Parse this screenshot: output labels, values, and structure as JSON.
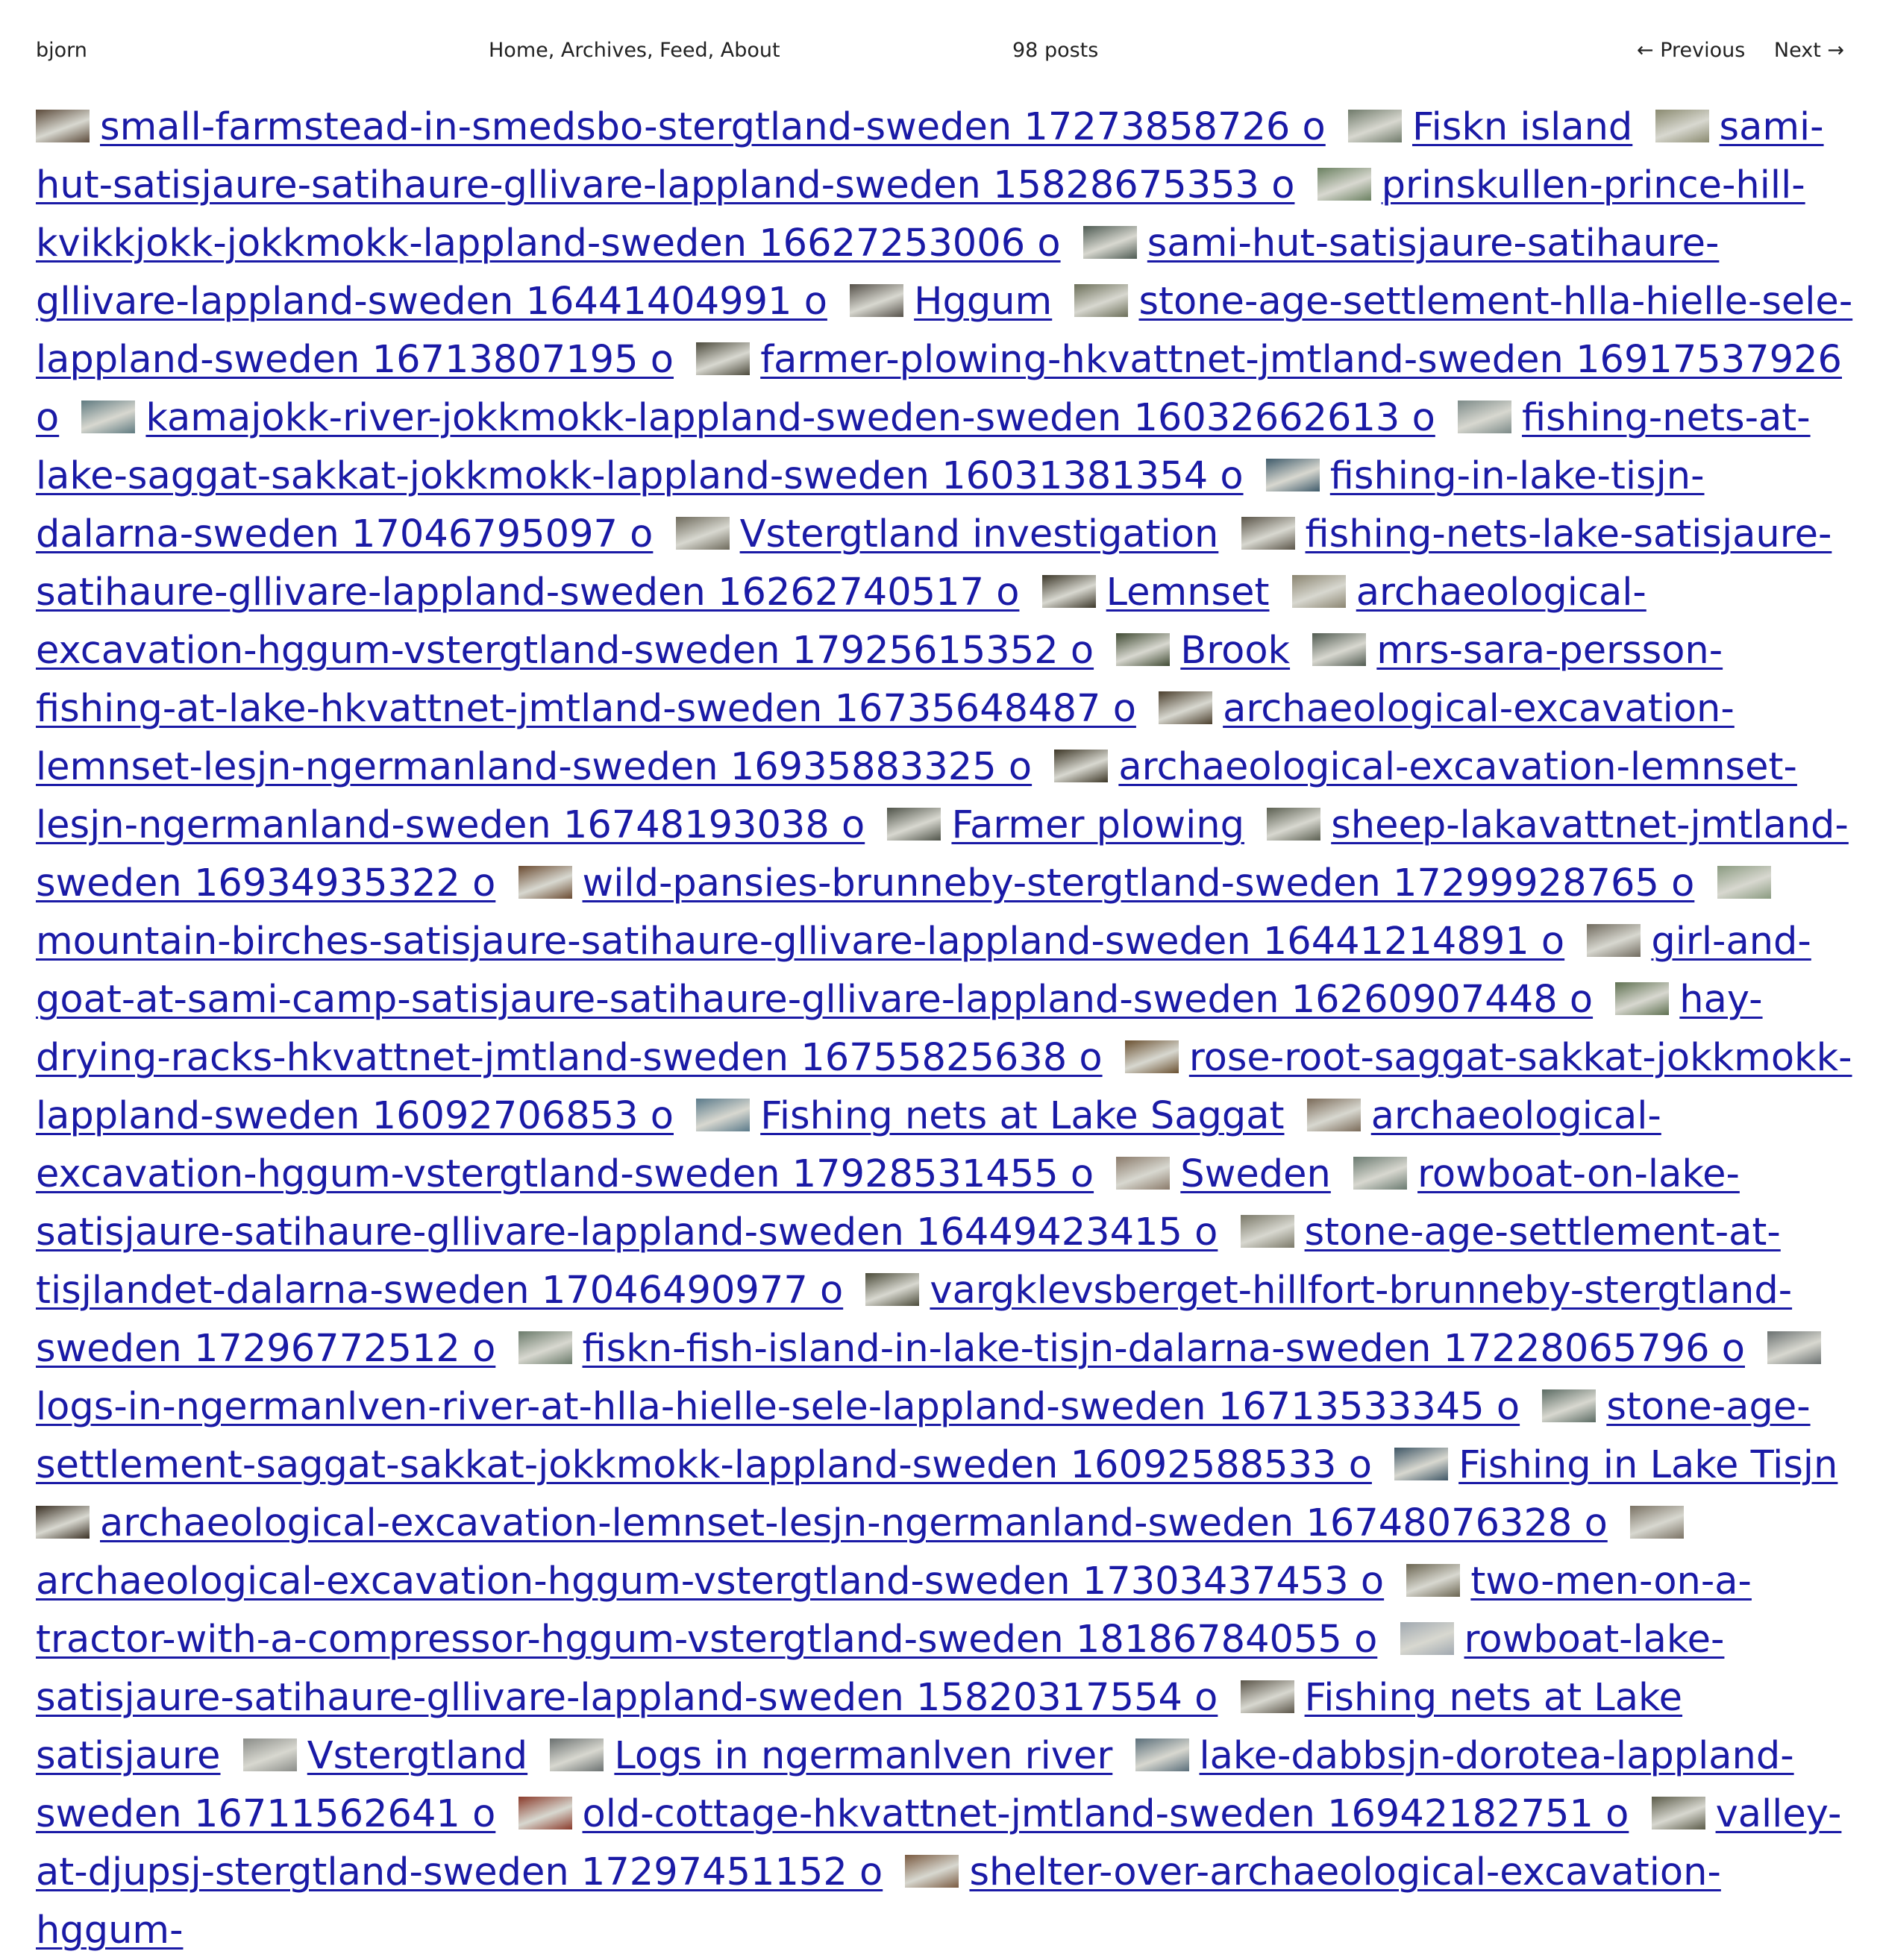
{
  "header": {
    "site_title": "bjorn",
    "nav": [
      "Home",
      "Archives",
      "Feed",
      "About"
    ],
    "post_count": "98 posts",
    "prev_label": "← Previous",
    "next_label": "Next →"
  },
  "posts": [
    {
      "title": "small-farmstead-in-smedsbo-stergtland-sweden 17273858726 o",
      "thumb_color": "#5b4a3a"
    },
    {
      "title": "Fiskn island",
      "thumb_color": "#6f7a6a"
    },
    {
      "title": "sami-hut-satisjaure-satihaure-gllivare-lappland-sweden 15828675353 o",
      "thumb_color": "#8a8a70"
    },
    {
      "title": "prinskullen-prince-hill-kvikkjokk-jokkmokk-lappland-sweden 16627253006 o",
      "thumb_color": "#6a8060"
    },
    {
      "title": "sami-hut-satisjaure-satihaure-gllivare-lappland-sweden 16441404991 o",
      "thumb_color": "#4d5a52"
    },
    {
      "title": "Hggum",
      "thumb_color": "#555049"
    },
    {
      "title": "stone-age-settlement-hlla-hielle-sele-lappland-sweden 16713807195 o",
      "thumb_color": "#6b6e58"
    },
    {
      "title": "farmer-plowing-hkvattnet-jmtland-sweden 16917537926 o",
      "thumb_color": "#4c4a3c"
    },
    {
      "title": "kamajokk-river-jokkmokk-lappland-sweden-sweden 16032662613 o",
      "thumb_color": "#5f7a80"
    },
    {
      "title": "fishing-nets-at-lake-saggat-sakkat-jokkmokk-lappland-sweden 16031381354 o",
      "thumb_color": "#7c8a88"
    },
    {
      "title": "fishing-in-lake-tisjn-dalarna-sweden 17046795097 o",
      "thumb_color": "#3e5a6a"
    },
    {
      "title": "Vstergtland investigation",
      "thumb_color": "#6e6a5c"
    },
    {
      "title": "fishing-nets-lake-satisjaure-satihaure-gllivare-lappland-sweden 16262740517 o",
      "thumb_color": "#5a5448"
    },
    {
      "title": "Lemnset",
      "thumb_color": "#3b3628"
    },
    {
      "title": "archaeological-excavation-hggum-vstergtland-sweden 17925615352 o",
      "thumb_color": "#8a8470"
    },
    {
      "title": "Brook",
      "thumb_color": "#3f4a32"
    },
    {
      "title": "mrs-sara-persson-fishing-at-lake-hkvattnet-jmtland-sweden 16735648487 o",
      "thumb_color": "#505a50"
    },
    {
      "title": "archaeological-excavation-lemnset-lesjn-ngermanland-sweden 16935883325 o",
      "thumb_color": "#4a3e2c"
    },
    {
      "title": "archaeological-excavation-lemnset-lesjn-ngermanland-sweden 16748193038 o",
      "thumb_color": "#3c3626"
    },
    {
      "title": "Farmer plowing",
      "thumb_color": "#4e5248"
    },
    {
      "title": "sheep-lakavattnet-jmtland-sweden 16934935322 o",
      "thumb_color": "#5a5e50"
    },
    {
      "title": "wild-pansies-brunneby-stergtland-sweden 17299928765 o",
      "thumb_color": "#6a4a30"
    },
    {
      "title": "mountain-birches-satisjaure-satihaure-gllivare-lappland-sweden 16441214891 o",
      "thumb_color": "#8a9a80"
    },
    {
      "title": "girl-and-goat-at-sami-camp-satisjaure-satihaure-gllivare-lappland-sweden 16260907448 o",
      "thumb_color": "#706a5e"
    },
    {
      "title": "hay-drying-racks-hkvattnet-jmtland-sweden 16755825638 o",
      "thumb_color": "#5e7050"
    },
    {
      "title": "rose-root-saggat-sakkat-jokkmokk-lappland-sweden 16092706853 o",
      "thumb_color": "#6a5030"
    },
    {
      "title": "Fishing nets at Lake Saggat",
      "thumb_color": "#5a7a8a"
    },
    {
      "title": "archaeological-excavation-hggum-vstergtland-sweden 17928531455 o",
      "thumb_color": "#7a6a58"
    },
    {
      "title": "Sweden",
      "thumb_color": "#8a7a6a"
    },
    {
      "title": "rowboat-on-lake-satisjaure-satihaure-gllivare-lappland-sweden 16449423415 o",
      "thumb_color": "#6a7a70"
    },
    {
      "title": "stone-age-settlement-at-tisjlandet-dalarna-sweden 17046490977 o",
      "thumb_color": "#7a7868"
    },
    {
      "title": "vargklevsberget-hillfort-brunneby-stergtland-sweden 17296772512 o",
      "thumb_color": "#4a4a38"
    },
    {
      "title": "fiskn-fish-island-in-lake-tisjn-dalarna-sweden 17228065796 o",
      "thumb_color": "#6a7a6a"
    },
    {
      "title": "logs-in-ngermanlven-river-at-hlla-hielle-sele-lappland-sweden 16713533345 o",
      "thumb_color": "#6a7070"
    },
    {
      "title": "stone-age-settlement-saggat-sakkat-jokkmokk-lappland-sweden 16092588533 o",
      "thumb_color": "#5a6a62"
    },
    {
      "title": "Fishing in Lake Tisjn",
      "thumb_color": "#3e5666"
    },
    {
      "title": "archaeological-excavation-lemnset-lesjn-ngermanland-sweden 16748076328 o",
      "thumb_color": "#3a3024"
    },
    {
      "title": "archaeological-excavation-hggum-vstergtland-sweden 17303437453 o",
      "thumb_color": "#7a7264"
    },
    {
      "title": "two-men-on-a-tractor-with-a-compressor-hggum-vstergtland-sweden 18186784055 o",
      "thumb_color": "#6a6450"
    },
    {
      "title": "rowboat-lake-satisjaure-satihaure-gllivare-lappland-sweden 15820317554 o",
      "thumb_color": "#a0a8b0"
    },
    {
      "title": "Fishing nets at Lake satisjaure",
      "thumb_color": "#5a5448"
    },
    {
      "title": "Vstergtland",
      "thumb_color": "#8a8c88"
    },
    {
      "title": "Logs in ngermanlven river",
      "thumb_color": "#6a7070"
    },
    {
      "title": "lake-dabbsjn-dorotea-lappland-sweden 16711562641 o",
      "thumb_color": "#5a6e7a"
    },
    {
      "title": "old-cottage-hkvattnet-jmtland-sweden 16942182751 o",
      "thumb_color": "#8a3a2a"
    },
    {
      "title": "valley-at-djupsj-stergtland-sweden 17297451152 o",
      "thumb_color": "#5a5a48"
    },
    {
      "title": "shelter-over-archaeological-excavation-hggum-",
      "thumb_color": "#7a5a40"
    }
  ]
}
